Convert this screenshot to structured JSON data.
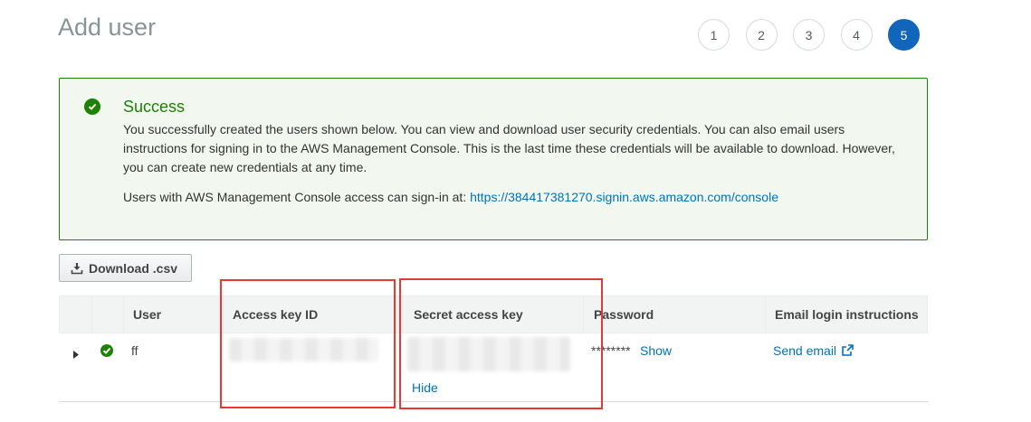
{
  "page": {
    "title": "Add user"
  },
  "steps": [
    {
      "label": "1",
      "active": false
    },
    {
      "label": "2",
      "active": false
    },
    {
      "label": "3",
      "active": false
    },
    {
      "label": "4",
      "active": false
    },
    {
      "label": "5",
      "active": true
    }
  ],
  "alert": {
    "title": "Success",
    "body": "You successfully created the users shown below. You can view and download user security credentials. You can also email users instructions for signing in to the AWS Management Console. This is the last time these credentials will be available to download. However, you can create new credentials at any time.",
    "console_prefix": "Users with AWS Management Console access can sign-in at:",
    "console_url": "https://384417381270.signin.aws.amazon.com/console",
    "color": "#1d8102"
  },
  "toolbar": {
    "download_label": "Download .csv"
  },
  "table": {
    "headers": {
      "user": "User",
      "access_key_id": "Access key ID",
      "secret_access_key": "Secret access key",
      "password": "Password",
      "email_login": "Email login instructions"
    },
    "rows": [
      {
        "user": "ff",
        "password_mask": "********",
        "show_label": "Show",
        "hide_label": "Hide",
        "send_email_label": "Send email"
      }
    ]
  },
  "colors": {
    "accent": "#1166bb",
    "link": "#0073bb",
    "highlight": "#e53935"
  }
}
